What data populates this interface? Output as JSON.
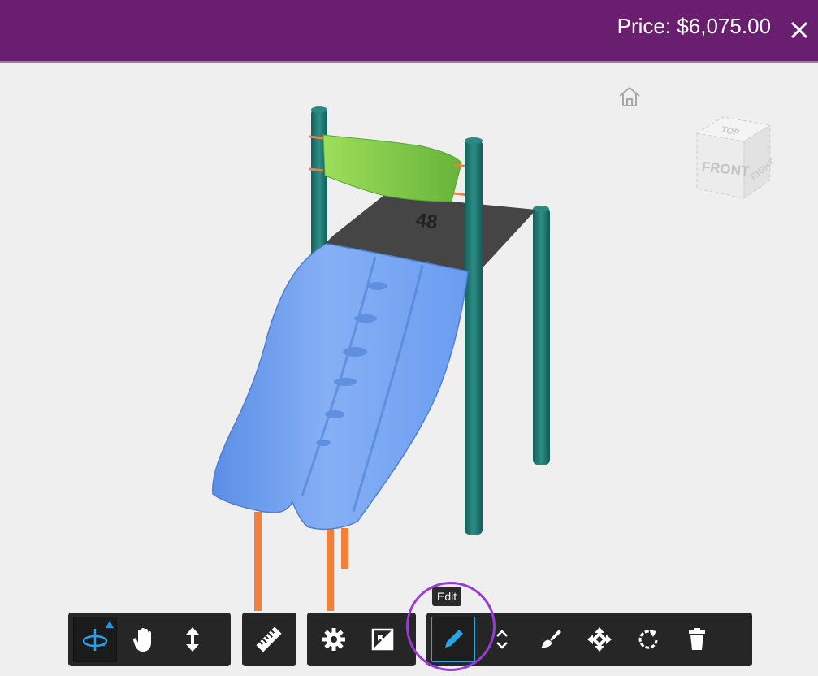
{
  "header": {
    "price": "Price: $6,075.00",
    "close_icon": "close-icon",
    "background_color": "#6a1e70"
  },
  "viewport": {
    "home_icon": "home-icon",
    "view_cube": {
      "top": "TOP",
      "front": "FRONT",
      "right": "RIGHT"
    },
    "model": {
      "deck_label": "48",
      "colors": {
        "slide": "#6fa2f2",
        "posts": "#1f7a73",
        "deck": "#454545",
        "canopy": "#7cc843",
        "support_legs": "#f0803a"
      }
    }
  },
  "toolbar": {
    "navigation": [
      {
        "name": "orbit",
        "icon": "orbit-icon",
        "active": true
      },
      {
        "name": "pan",
        "icon": "hand-icon"
      },
      {
        "name": "zoom",
        "icon": "vertical-arrows-icon"
      }
    ],
    "measure": [
      {
        "name": "measure",
        "icon": "ruler-icon"
      }
    ],
    "settings": [
      {
        "name": "settings",
        "icon": "gear-icon"
      },
      {
        "name": "fullscreen",
        "icon": "fullscreen-icon"
      }
    ],
    "edit": [
      {
        "name": "edit",
        "icon": "pencil-icon",
        "active": true
      },
      {
        "name": "move-vertical",
        "icon": "chevron-up-down-icon"
      },
      {
        "name": "paint",
        "icon": "brush-icon"
      },
      {
        "name": "move",
        "icon": "move-arrows-icon"
      },
      {
        "name": "rotate",
        "icon": "rotate-icon"
      },
      {
        "name": "delete",
        "icon": "trash-icon"
      }
    ],
    "tooltip": "Edit",
    "accent_color": "#2aa6e8",
    "highlight_color": "#9a3bd8"
  }
}
